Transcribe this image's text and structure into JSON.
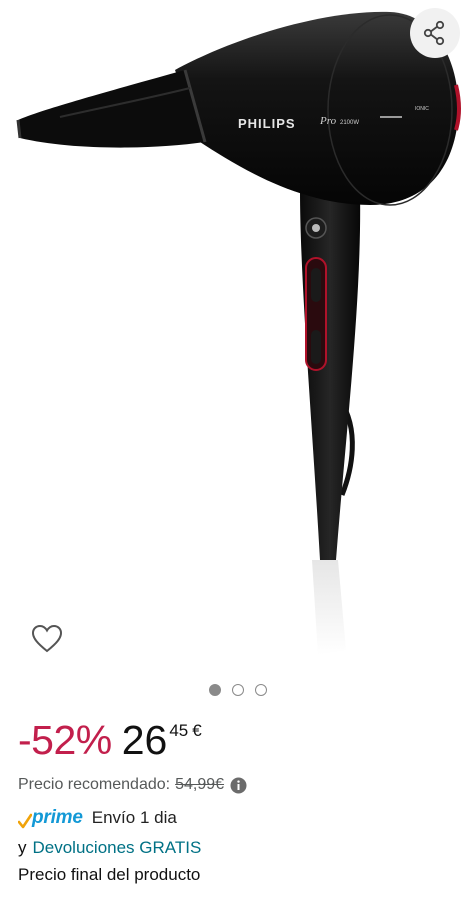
{
  "product": {
    "brand_print": "PHILIPS",
    "model_print": "Pro",
    "wattage_print": "2100W",
    "ionic_print": "IONIC"
  },
  "gallery": {
    "image_count": 3,
    "active_index": 0,
    "share_icon": "share-icon",
    "wishlist_icon": "heart-outline-icon"
  },
  "pricing": {
    "discount": "-52%",
    "price_whole": "26",
    "price_fraction": "45",
    "currency": "€",
    "recommended_label": "Precio recomendado:",
    "recommended_value": "54,99€"
  },
  "shipping": {
    "prime_label": "prime",
    "delivery_text": "Envío 1 dia",
    "connector": "y",
    "returns_text": "Devoluciones GRATIS",
    "final_price_text": "Precio final del producto"
  },
  "colors": {
    "discount": "#c21f4c",
    "link": "#007185",
    "prime": "#1399d6",
    "prime_check": "#f0a30a"
  }
}
